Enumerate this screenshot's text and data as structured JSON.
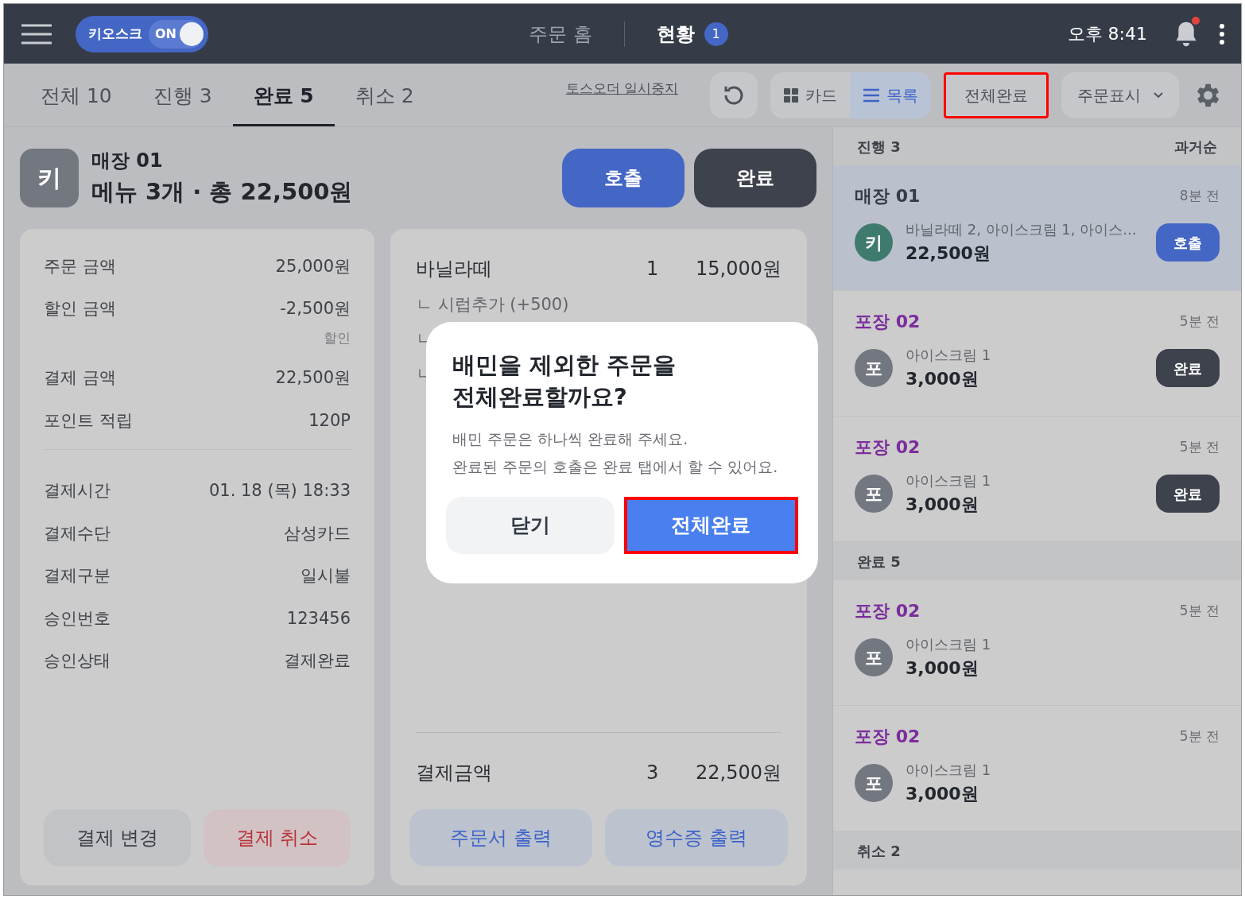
{
  "header": {
    "kiosk": {
      "label": "키오스크",
      "toggle_label": "ON",
      "on": true
    },
    "nav": [
      {
        "label": "주문 홈",
        "selected": false
      },
      {
        "label": "현황",
        "selected": true,
        "badge": "1"
      }
    ],
    "time": "오후 8:41",
    "has_unread": true
  },
  "tabs": [
    {
      "label": "전체 10",
      "selected": false
    },
    {
      "label": "진행 3",
      "selected": false
    },
    {
      "label": "완료 5",
      "selected": true
    },
    {
      "label": "취소 2",
      "selected": false
    }
  ],
  "toolbar": {
    "pause_link": "토스오더 일시중지",
    "view_toggle": [
      {
        "label": "카드",
        "kind": "grid",
        "selected": false
      },
      {
        "label": "목록",
        "kind": "list",
        "selected": true
      }
    ],
    "complete_all": {
      "label": "전체완료",
      "highlighted": true
    },
    "display_select": "주문표시"
  },
  "order": {
    "avatar": "키",
    "title": "매장 01",
    "summary": "메뉴 3개 · 총 22,500원",
    "buttons": [
      {
        "label": "호출",
        "kind": "primary"
      },
      {
        "label": "완료",
        "kind": "dark"
      }
    ]
  },
  "payment": {
    "groups": [
      [
        {
          "label": "주문 금액",
          "value": "25,000원"
        },
        {
          "label": "할인 금액",
          "value": "-2,500원",
          "note": "할인"
        },
        {
          "label": "결제 금액",
          "value": "22,500원"
        },
        {
          "label": "포인트 적립",
          "value": "120P"
        }
      ],
      [
        {
          "label": "결제시간",
          "value": "01. 18 (목) 18:33"
        },
        {
          "label": "결제수단",
          "value": "삼성카드"
        },
        {
          "label": "결제구분",
          "value": "일시불"
        },
        {
          "label": "승인번호",
          "value": "123456"
        },
        {
          "label": "승인상태",
          "value": "결제완료"
        }
      ]
    ],
    "buttons": [
      {
        "label": "결제 변경",
        "kind": "neutral"
      },
      {
        "label": "결제 취소",
        "kind": "danger"
      }
    ]
  },
  "items": {
    "lines": [
      {
        "name": "바닐라떼",
        "qty": "1",
        "price": "15,000원",
        "options": [
          "ㄴ 시럽추가 (+500)",
          "ㄴ",
          "ㄴ"
        ]
      }
    ],
    "total": {
      "label": "결제금액",
      "qty": "3",
      "price": "22,500원"
    },
    "buttons": [
      {
        "label": "주문서 출력"
      },
      {
        "label": "영수증 출력"
      }
    ]
  },
  "modal": {
    "title_lines": [
      "배민을 제외한 주문을",
      "전체완료할까요?"
    ],
    "body_lines": [
      "배민 주문은 하나씩 완료해 주세요.",
      "완료된 주문의 호출은 완료 탭에서 할 수 있어요."
    ],
    "buttons": [
      {
        "label": "닫기",
        "kind": "secondary",
        "highlighted": false
      },
      {
        "label": "전체완료",
        "kind": "primary",
        "highlighted": true
      }
    ]
  },
  "list": {
    "sections": [
      {
        "label": "진행 3",
        "sort": "과거순",
        "orders": [
          {
            "channel": "매장 01",
            "color": "#353b47",
            "avatar": "키",
            "kind": "kiosk",
            "time": "8분 전",
            "items": "바닐라떼 2, 아이스크림 1, 아이스...",
            "amount": "22,500원",
            "action": {
              "label": "호출",
              "kind": "primary"
            },
            "selected": true
          },
          {
            "channel": "포장 02",
            "color": "#7b2d9c",
            "avatar": "포",
            "kind": "takeout",
            "time": "5분 전",
            "items": "아이스크림 1",
            "amount": "3,000원",
            "action": {
              "label": "완료",
              "kind": "dark"
            },
            "selected": false
          },
          {
            "channel": "포장 02",
            "color": "#7b2d9c",
            "avatar": "포",
            "kind": "takeout",
            "time": "5분 전",
            "items": "아이스크림 1",
            "amount": "3,000원",
            "action": {
              "label": "완료",
              "kind": "dark"
            },
            "selected": false
          }
        ]
      },
      {
        "label": "완료 5",
        "orders": [
          {
            "channel": "포장 02",
            "color": "#7b2d9c",
            "avatar": "포",
            "kind": "takeout",
            "time": "5분 전",
            "items": "아이스크림 1",
            "amount": "3,000원",
            "selected": false
          },
          {
            "channel": "포장 02",
            "color": "#7b2d9c",
            "avatar": "포",
            "kind": "takeout",
            "time": "5분 전",
            "items": "아이스크림 1",
            "amount": "3,000원",
            "selected": false
          }
        ]
      },
      {
        "label": "취소 2"
      }
    ]
  }
}
